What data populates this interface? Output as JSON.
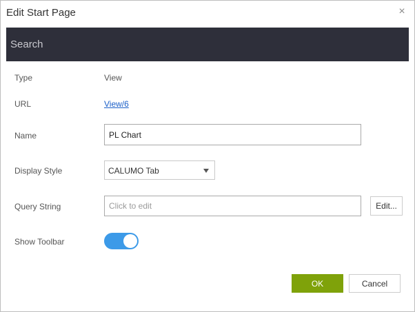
{
  "dialog": {
    "title": "Edit Start Page",
    "close_icon": "close-icon",
    "close_glyph": "×"
  },
  "search": {
    "placeholder": "Search",
    "value": ""
  },
  "fields": {
    "type_label": "Type",
    "type_value": "View",
    "url_label": "URL",
    "url_value": "View/6",
    "name_label": "Name",
    "name_value": "PL Chart",
    "display_style_label": "Display Style",
    "display_style_value": "CALUMO Tab",
    "query_string_label": "Query String",
    "query_string_placeholder": "Click to edit",
    "query_string_value": "",
    "edit_button_label": "Edit...",
    "show_toolbar_label": "Show Toolbar",
    "show_toolbar_on": true
  },
  "footer": {
    "ok_label": "OK",
    "cancel_label": "Cancel"
  },
  "colors": {
    "search_bar_bg": "#2e2f3a",
    "ok_button_bg": "#7fa20a",
    "toggle_on_bg": "#3c9ae8",
    "link": "#1a5fc8"
  }
}
